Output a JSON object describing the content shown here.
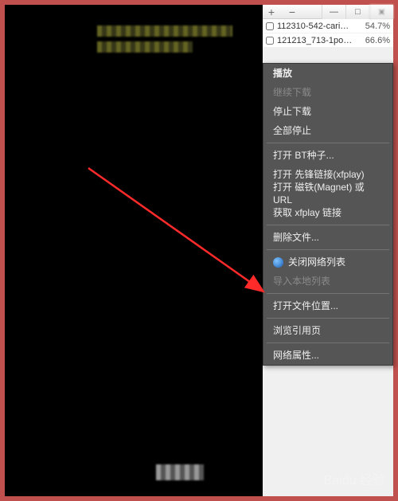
{
  "titlebar": {
    "add_tooltip": "+",
    "remove_tooltip": "−"
  },
  "file_list": [
    {
      "name": "112310-542-cari…",
      "percent": "54.7%",
      "checked": false
    },
    {
      "name": "121213_713-1po…",
      "percent": "66.6%",
      "checked": false
    }
  ],
  "context_menu": {
    "play": "播放",
    "resume_download": "继续下载",
    "stop_download": "停止下载",
    "stop_all": "全部停止",
    "open_bt_seed": "打开 BT种子...",
    "open_xfplay_link": "打开 先锋链接(xfplay)",
    "open_magnet": "打开 磁铁(Magnet) 或 URL",
    "get_xfplay_link": "获取 xfplay 链接",
    "delete_file": "删除文件...",
    "close_network_list": "关闭网络列表",
    "import_local_list": "导入本地列表",
    "open_file_location": "打开文件位置...",
    "browse_ref_page": "浏览引用页",
    "network_properties": "网络属性..."
  },
  "watermark": "Baidu 经验"
}
